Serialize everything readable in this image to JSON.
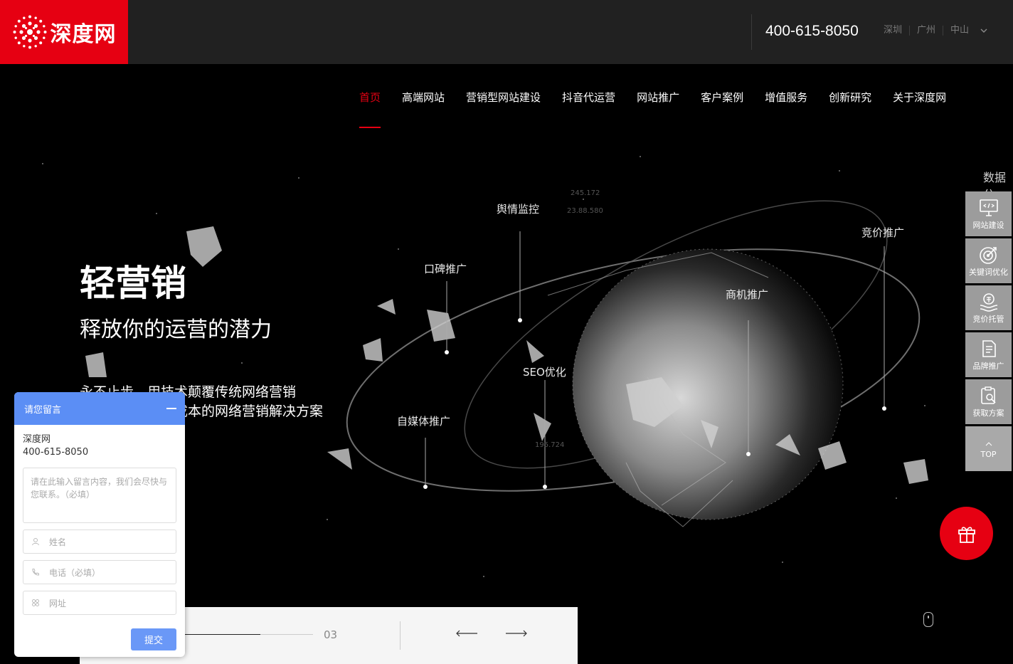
{
  "brand": {
    "name": "深度网",
    "color": "#e60012"
  },
  "header": {
    "phone": "400-615-8050",
    "cities": [
      "深圳",
      "广州",
      "中山"
    ]
  },
  "nav": [
    {
      "label": "首页",
      "active": true
    },
    {
      "label": "高端网站"
    },
    {
      "label": "营销型网站建设"
    },
    {
      "label": "抖音代运营"
    },
    {
      "label": "网站推广"
    },
    {
      "label": "客户案例"
    },
    {
      "label": "增值服务"
    },
    {
      "label": "创新研究"
    },
    {
      "label": "关于深度网"
    }
  ],
  "hero": {
    "title": "轻营销",
    "subtitle": "释放你的运营的潜力",
    "desc_line1": "永不止步，用技术颠覆传统网络营销",
    "desc_line2": "有效、便捷、低成本的网络营销解决方案",
    "side_text": "数据分",
    "tags": [
      "舆情监控",
      "口碑推广",
      "竞价推广",
      "商机推广",
      "SEO优化",
      "自媒体推广"
    ],
    "numbers": [
      "245.172",
      "23.88.580",
      "195.724"
    ]
  },
  "right_tools": [
    {
      "label": "网站建设",
      "icon": "code-monitor-icon"
    },
    {
      "label": "关键词优化",
      "icon": "target-icon"
    },
    {
      "label": "竞价托管",
      "icon": "coin-hand-icon"
    },
    {
      "label": "品牌推广",
      "icon": "document-icon"
    },
    {
      "label": "获取方案",
      "icon": "clipboard-search-icon"
    },
    {
      "label": "TOP",
      "icon": "arrow-up-icon"
    }
  ],
  "slider": {
    "page": "03"
  },
  "message_box": {
    "title": "请您留言",
    "company": "深度网",
    "phone": "400-615-8050",
    "content_placeholder": "请在此输入留言内容，我们会尽快与您联系。（必填）",
    "name_placeholder": "姓名",
    "tel_placeholder": "电话（必填）",
    "url_placeholder": "网址",
    "submit": "提交"
  }
}
